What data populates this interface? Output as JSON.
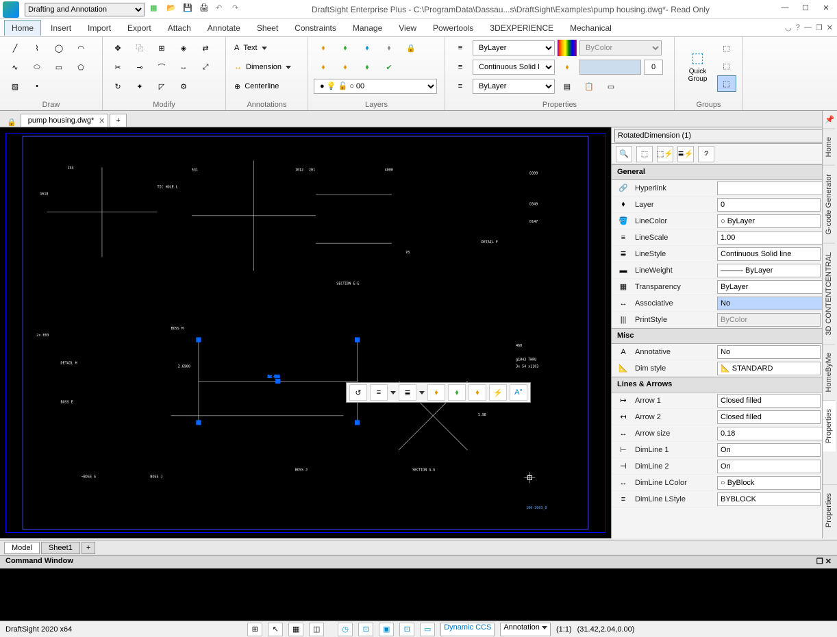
{
  "title": "DraftSight Enterprise Plus - C:\\ProgramData\\Dassau...s\\DraftSight\\Examples\\pump housing.dwg*- Read Only",
  "workspace": "Drafting and Annotation",
  "menu": [
    "Home",
    "Insert",
    "Import",
    "Export",
    "Attach",
    "Annotate",
    "Sheet",
    "Constraints",
    "Manage",
    "View",
    "Powertools",
    "3DEXPERIENCE",
    "Mechanical"
  ],
  "ribbon_groups": [
    "Draw",
    "Modify",
    "Annotations",
    "Layers",
    "Properties",
    "Groups"
  ],
  "annotations": {
    "text": "Text",
    "dim": "Dimension",
    "center": "Centerline"
  },
  "layer_combo": "0",
  "prop_bylayer": "ByLayer",
  "prop_linetype": "Continuous   Solid l",
  "prop_lineweight": "ByLayer",
  "prop_bycolor": "ByColor",
  "prop_transp": "0",
  "quickgroup": "Quick\nGroup",
  "filetab": "pump housing.dwg*",
  "selection": "RotatedDimension (1)",
  "sections": {
    "general": "General",
    "misc": "Misc",
    "lines": "Lines & Arrows"
  },
  "props_general": [
    {
      "icon": "🔗",
      "label": "Hyperlink",
      "val": "",
      "type": "text"
    },
    {
      "icon": "⬧",
      "label": "Layer",
      "val": "0",
      "type": "dd"
    },
    {
      "icon": "🪣",
      "label": "LineColor",
      "val": "○ ByLayer",
      "type": "dd"
    },
    {
      "icon": "≡",
      "label": "LineScale",
      "val": "1.00",
      "type": "text"
    },
    {
      "icon": "≣",
      "label": "LineStyle",
      "val": "Continuous    Solid line",
      "type": "dd"
    },
    {
      "icon": "▬",
      "label": "LineWeight",
      "val": "——— ByLayer",
      "type": "dd"
    },
    {
      "icon": "▦",
      "label": "Transparency",
      "val": "ByLayer",
      "type": "text"
    },
    {
      "icon": "↔",
      "label": "Associative",
      "val": "No",
      "type": "hl"
    },
    {
      "icon": "|||",
      "label": "PrintStyle",
      "val": "ByColor",
      "type": "ro"
    }
  ],
  "props_misc": [
    {
      "icon": "A",
      "label": "Annotative",
      "val": "No",
      "type": "dd"
    },
    {
      "icon": "📐",
      "label": "Dim style",
      "val": "📐 STANDARD",
      "type": "dd"
    }
  ],
  "props_lines": [
    {
      "icon": "↦",
      "label": "Arrow 1",
      "val": "Closed filled",
      "type": "dd"
    },
    {
      "icon": "↤",
      "label": "Arrow 2",
      "val": "Closed filled",
      "type": "dd"
    },
    {
      "icon": "↔",
      "label": "Arrow size",
      "val": "0.18",
      "type": "text"
    },
    {
      "icon": "⊢",
      "label": "DimLine 1",
      "val": "On",
      "type": "dd"
    },
    {
      "icon": "⊣",
      "label": "DimLine 2",
      "val": "On",
      "type": "dd"
    },
    {
      "icon": "↔",
      "label": "DimLine LColor",
      "val": "○ ByBlock",
      "type": "dd"
    },
    {
      "icon": "≡",
      "label": "DimLine LStyle",
      "val": "BYBLOCK",
      "type": "dd"
    }
  ],
  "side_tabs": [
    "Home",
    "G-code Generator",
    "3D CONTENTCENTRAL",
    "HomeByMe",
    "Properties"
  ],
  "sheet_tabs": [
    "Model",
    "Sheet1"
  ],
  "cmd_title": "Command Window",
  "status_app": "DraftSight 2020 x64",
  "status_dccs": "Dynamic CCS",
  "status_anno": "Annotation",
  "status_scale": "(1:1)",
  "status_coords": "(31.42,2.04,0.00)"
}
